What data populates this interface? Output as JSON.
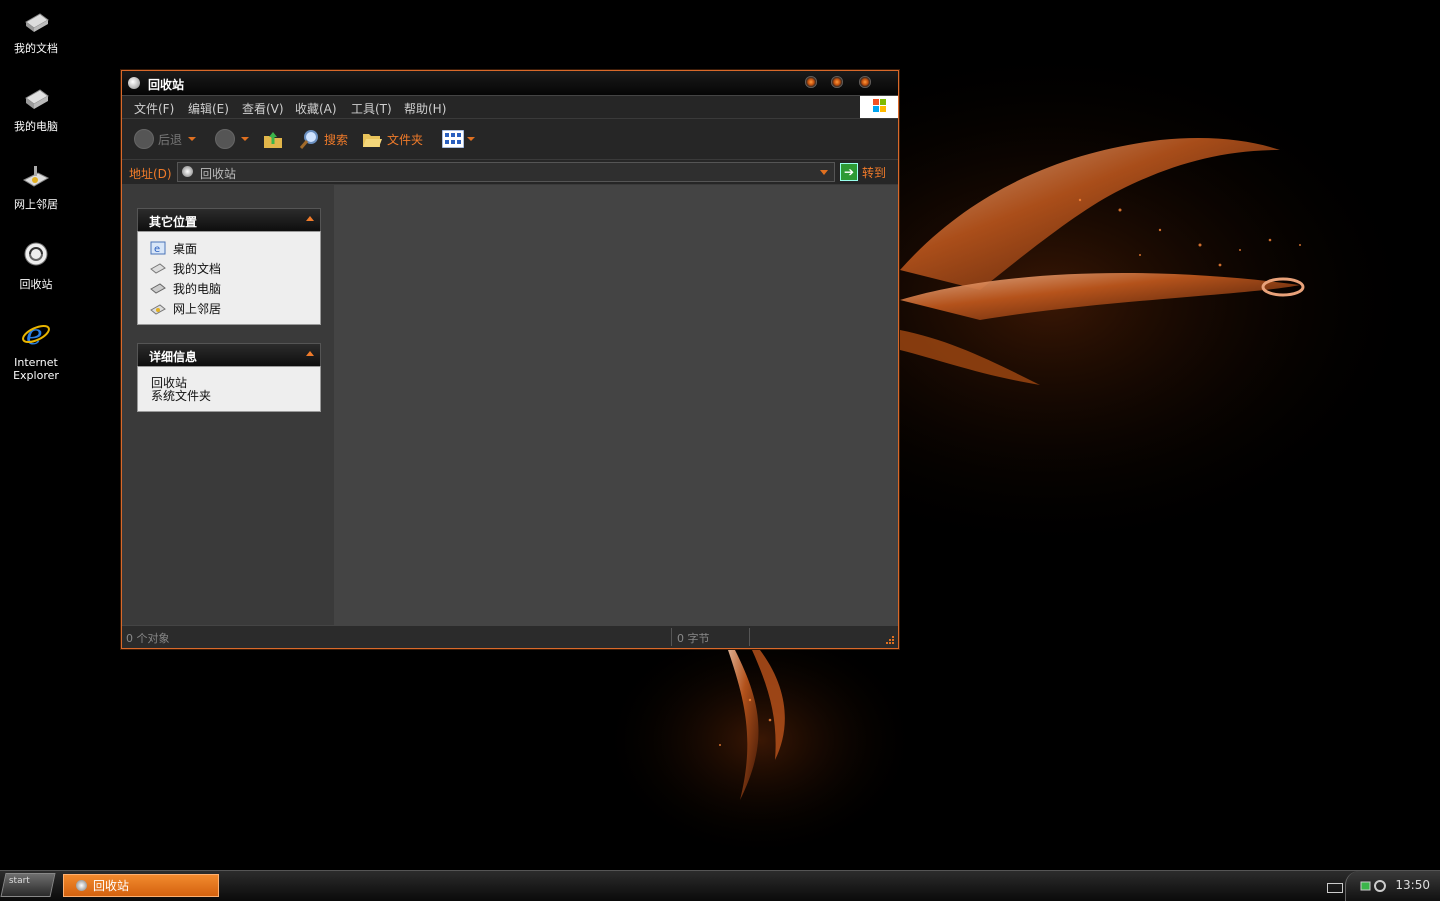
{
  "desktop": {
    "icons": [
      {
        "label": "我的文档"
      },
      {
        "label": "我的电脑"
      },
      {
        "label": "网上邻居"
      },
      {
        "label": "回收站"
      },
      {
        "label": "Internet Explorer"
      }
    ]
  },
  "window": {
    "title": "回收站",
    "menu": [
      "文件(F)",
      "编辑(E)",
      "查看(V)",
      "收藏(A)",
      "工具(T)",
      "帮助(H)"
    ],
    "toolbar": {
      "back": "后退",
      "search": "搜索",
      "folders": "文件夹"
    },
    "address": {
      "label": "地址(D)",
      "value": "回收站",
      "go": "转到"
    },
    "other_places": {
      "title": "其它位置",
      "items": [
        "桌面",
        "我的文档",
        "我的电脑",
        "网上邻居"
      ]
    },
    "details": {
      "title": "详细信息",
      "line1": "回收站",
      "line2": "系统文件夹"
    },
    "status": {
      "objects": "0 个对象",
      "size": "0 字节"
    }
  },
  "taskbar": {
    "start": "start",
    "task": "回收站",
    "clock": "13:50"
  },
  "colors": {
    "accent": "#f07b2a",
    "window_border": "#d9692a"
  }
}
